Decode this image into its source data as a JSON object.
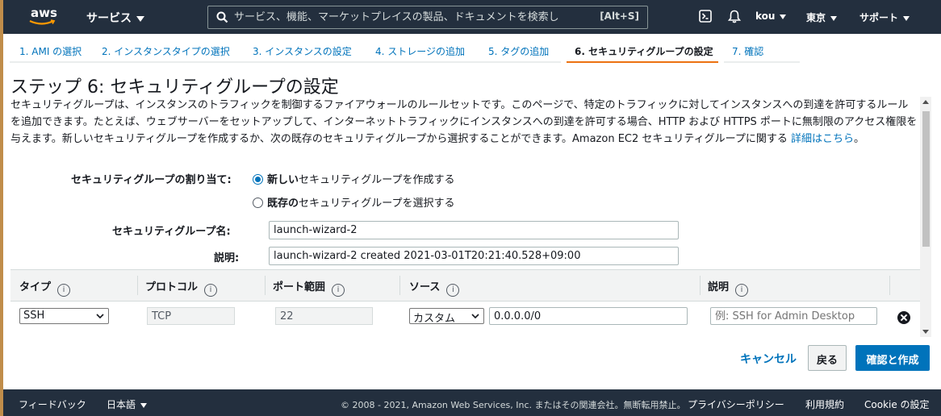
{
  "header": {
    "logo_text": "aws",
    "services_label": "サービス",
    "search_placeholder": "サービス、機能、マーケットプレイスの製品、ドキュメントを検索し",
    "search_shortcut": "[Alt+S]",
    "user": "kou",
    "region": "東京",
    "support": "サポート",
    "icons": [
      "cloudshell-icon",
      "bell-icon"
    ]
  },
  "wizard_tabs": [
    {
      "label": "1. AMI の選択",
      "active": false
    },
    {
      "label": "2. インスタンスタイプの選択",
      "active": false
    },
    {
      "label": "3. インスタンスの設定",
      "active": false
    },
    {
      "label": "4. ストレージの追加",
      "active": false
    },
    {
      "label": "5. タグの追加",
      "active": false
    },
    {
      "label": "6. セキュリティグループの設定",
      "active": true
    },
    {
      "label": "7. 確認",
      "active": false
    }
  ],
  "main": {
    "title": "ステップ 6: セキュリティグループの設定",
    "description": "セキュリティグループは、インスタンスのトラフィックを制御するファイアウォールのルールセットです。このページで、特定のトラフィックに対してインスタンスへの到達を許可するルールを追加できます。たとえば、ウェブサーバーをセットアップして、インターネットトラフィックにインスタンスへの到達を許可する場合、HTTP および HTTPS ポートに無制限のアクセス権限を与えます。新しいセキュリティグループを作成するか、次の既存のセキュリティグループから選択することができます。Amazon EC2 セキュリティグループに関する",
    "learn_more": "詳細はこちら",
    "desc_tail": "。",
    "assign_label": "セキュリティグループの割り当て:",
    "radio_new_bold": "新しい",
    "radio_new_rest": "セキュリティグループを作成する",
    "radio_existing_bold": "既存の",
    "radio_existing_rest": "セキュリティグループを選択する",
    "radio_selected": "new",
    "name_label": "セキュリティグループ名:",
    "name_value": "launch-wizard-2",
    "desc_label": "説明:",
    "desc_value": "launch-wizard-2 created 2021-03-01T20:21:40.528+09:00"
  },
  "rules_table": {
    "columns": [
      "タイプ",
      "プロトコル",
      "ポート範囲",
      "ソース",
      "説明"
    ],
    "info_glyph": "i",
    "rows": [
      {
        "type": "SSH",
        "protocol": "TCP",
        "port": "22",
        "source_type": "カスタム",
        "source_value": "0.0.0.0/0",
        "description_placeholder": "例: SSH for Admin Desktop"
      }
    ]
  },
  "actions": {
    "cancel": "キャンセル",
    "back": "戻る",
    "review": "確認と作成"
  },
  "footer": {
    "feedback": "フィードバック",
    "language": "日本語",
    "copyright": "© 2008 - 2021, Amazon Web Services, Inc. またはその関連会社。無断転用禁止。",
    "privacy": "プライバシーポリシー",
    "terms": "利用規約",
    "cookies": "Cookie の設定"
  },
  "colors": {
    "nav_bg": "#232f3e",
    "link": "#0073bb",
    "active_tab": "#ec7211",
    "primary_button": "#0073bb"
  }
}
